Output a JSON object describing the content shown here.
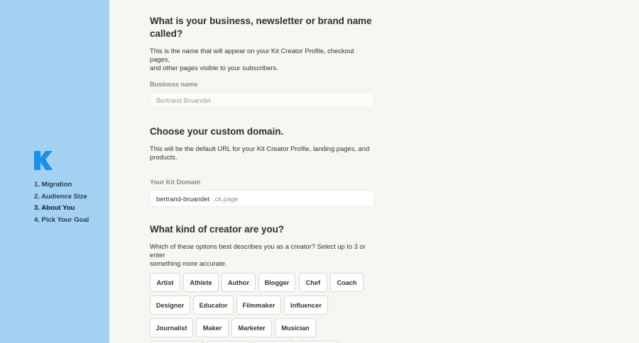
{
  "sidebar": {
    "logo_icon": "kit-logo-icon",
    "steps": [
      {
        "label": "1. Migration"
      },
      {
        "label": "2. Audience Size"
      },
      {
        "label": "3. About You"
      },
      {
        "label": "4. Pick Your Goal"
      }
    ]
  },
  "business": {
    "heading_line1": "What is your business, newsletter or brand name",
    "heading_line2": "called?",
    "description_line1": "This is the name that will appear on your Kit Creator Profile, checkout pages,",
    "description_line2": "and other pages visible to your subscribers.",
    "field_label": "Business name",
    "field_placeholder": "Bertrand Bruandet"
  },
  "domain": {
    "heading": "Choose your custom domain.",
    "description_line1": "This will be the default URL for your Kit Creator Profile, landing pages, and",
    "description_line2": "products.",
    "field_label": "Your Kit Domain",
    "field_value": "bertrand-bruandet",
    "field_suffix": ".ck.page"
  },
  "creator": {
    "heading": "What kind of creator are you?",
    "description_line1": "Which of these options best describes you as a creator? Select up to 3 or enter",
    "description_line2": "something more accurate.",
    "options": [
      "Artist",
      "Athlete",
      "Author",
      "Blogger",
      "Chef",
      "Coach",
      "Designer",
      "Educator",
      "Filmmaker",
      "Influencer",
      "Journalist",
      "Maker",
      "Marketer",
      "Musician"
    ]
  },
  "colors": {
    "sidebar_bg": "#a3d2f2",
    "logo": "#1e8fe6",
    "page_bg": "#f7f6f3"
  }
}
